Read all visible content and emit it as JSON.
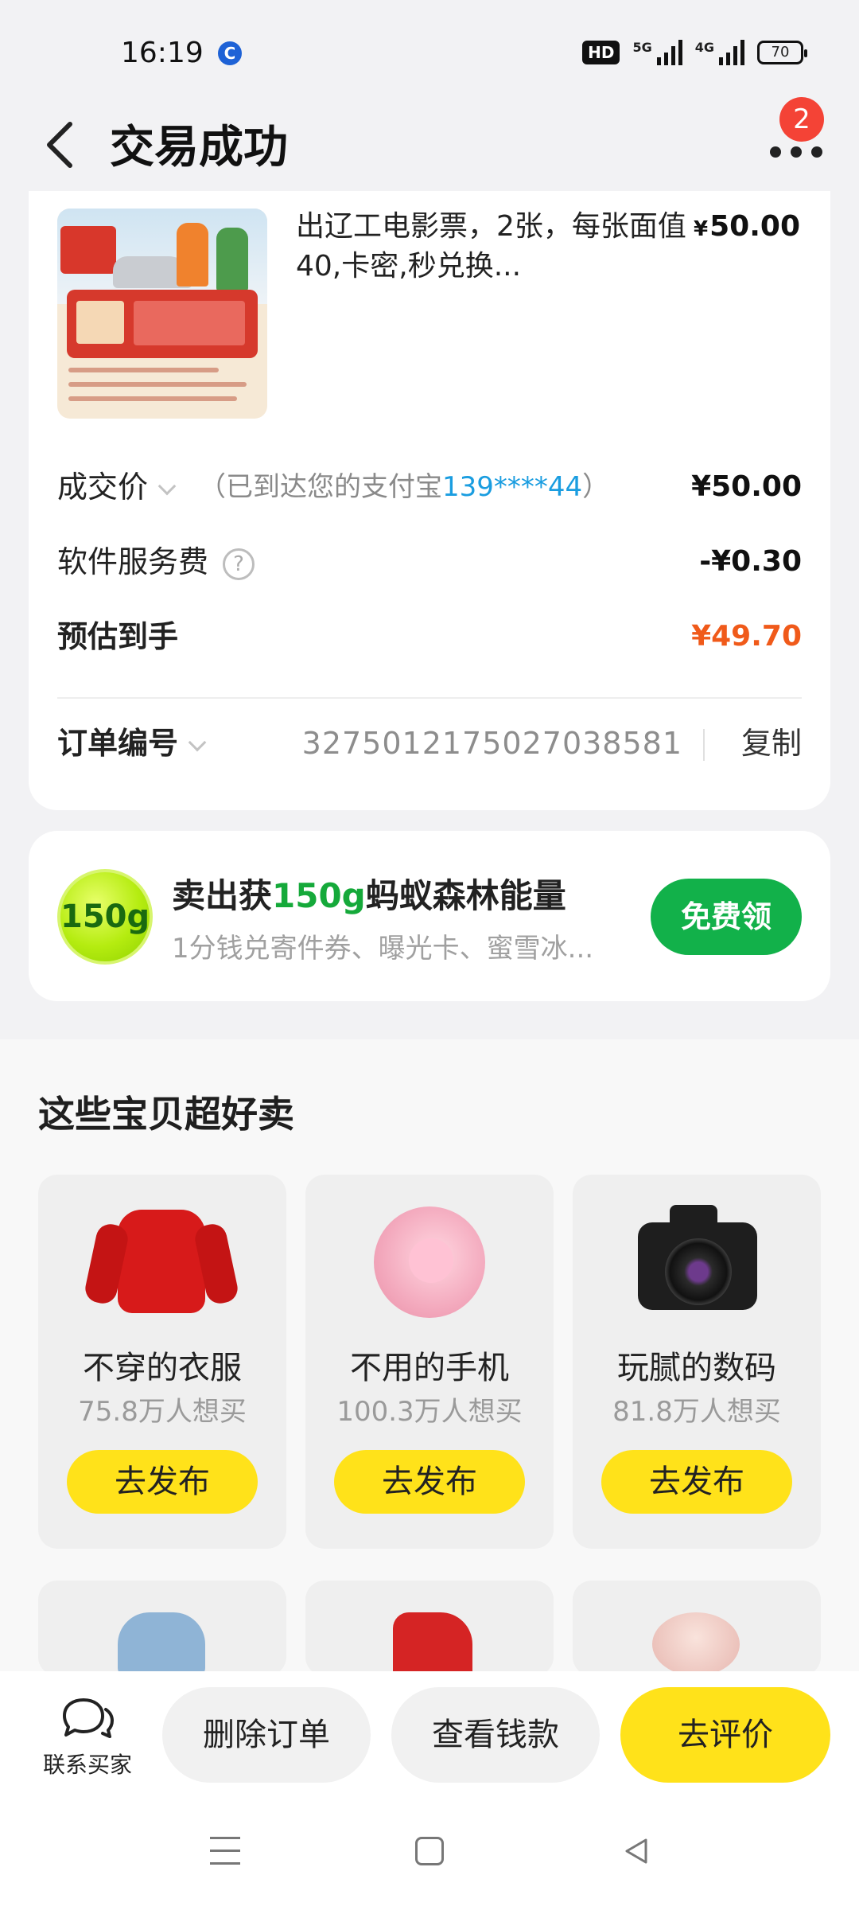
{
  "status_bar": {
    "time": "16:19",
    "app_indicator": "C",
    "hd_label": "HD",
    "sig1_label": "5G",
    "sig2_label": "4G",
    "battery": "70"
  },
  "header": {
    "title": "交易成功",
    "notification_count": "2"
  },
  "order": {
    "item_title": "出辽工电影票，2张，每张面值40,卡密,秒兑换...",
    "item_price": "50.00",
    "currency": "¥",
    "deal_price_label": "成交价",
    "deal_note_prefix": "（已到达您的支付宝",
    "deal_note_account": "139****44",
    "deal_note_suffix": "）",
    "deal_price": "¥50.00",
    "service_fee_label": "软件服务费",
    "service_fee_help": "?",
    "service_fee": "-¥0.30",
    "estimate_label": "预估到手",
    "estimate": "¥49.70",
    "order_no_label": "订单编号",
    "order_no": "3275012175027038581",
    "copy_label": "复制"
  },
  "energy": {
    "ball_text": "150g",
    "title_prefix": "卖出获",
    "title_highlight": "150g",
    "title_suffix": "蚂蚁森林能量",
    "subtitle": "1分钱兑寄件券、曝光卡、蜜雪冰...",
    "button": "免费领"
  },
  "recommend": {
    "title": "这些宝贝超好卖",
    "items": [
      {
        "name": "不穿的衣服",
        "want": "75.8万人想买",
        "button": "去发布",
        "icon": "sweater-icon"
      },
      {
        "name": "不用的手机",
        "want": "100.3万人想买",
        "button": "去发布",
        "icon": "phone-icon"
      },
      {
        "name": "玩腻的数码",
        "want": "81.8万人想买",
        "button": "去发布",
        "icon": "camera-icon"
      }
    ]
  },
  "actions": {
    "contact": "联系买家",
    "delete": "删除订单",
    "view_money": "查看钱款",
    "review": "去评价"
  },
  "colors": {
    "accent_yellow": "#ffe21a",
    "green": "#12b14a",
    "orange": "#f05a1a",
    "link_blue": "#1a9de0"
  }
}
